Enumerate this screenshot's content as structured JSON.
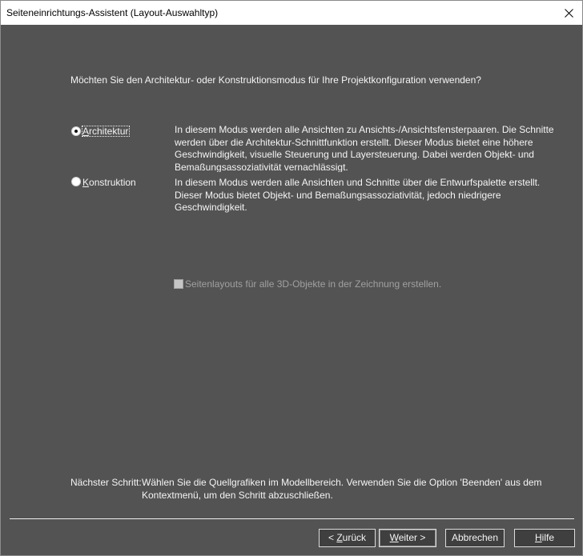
{
  "window": {
    "title": "Seiteneinrichtungs-Assistent (Layout-Auswahltyp)"
  },
  "icons": {
    "close": "close-icon"
  },
  "colors": {
    "titlebar_bg": "#ffffff",
    "body_bg": "#535353",
    "text": "#f4f4f4",
    "disabled_text": "#a0a0a0",
    "button_bg": "#3f3f3f",
    "button_border": "#dcdcdc",
    "separator": "#eeeeee"
  },
  "question": "Möchten Sie den Architektur- oder Konstruktionsmodus für Ihre Projektkonfiguration verwenden?",
  "modes": [
    {
      "label": "Architektur",
      "mnemonic_index": 0,
      "selected": true,
      "focused": true,
      "description_lines": [
        "In diesem Modus werden alle Ansichten zu Ansichts-/Ansichtsfensterpaaren. Die Schnitte",
        "werden über die Architektur-Schnittfunktion erstellt. Dieser Modus bietet eine höhere",
        "Geschwindigkeit, visuelle Steuerung und Layersteuerung. Dabei werden Objekt- und",
        "Bemaßungsassoziativität vernachlässigt."
      ]
    },
    {
      "label": "Konstruktion",
      "mnemonic_index": 0,
      "selected": false,
      "focused": false,
      "description_lines": [
        "In diesem Modus werden alle Ansichten und Schnitte über die Entwurfspalette erstellt.",
        "Dieser Modus bietet Objekt- und Bemaßungsassoziativität, jedoch niedrigere",
        "Geschwindigkeit."
      ]
    }
  ],
  "layout_checkbox": {
    "label": "Seitenlayouts für alle 3D-Objekte in der Zeichnung erstellen.",
    "checked": false,
    "disabled": true
  },
  "next_step": {
    "heading": "Nächster Schritt:",
    "lines": [
      "Wählen Sie die Quellgrafiken im Modellbereich. Verwenden Sie die Option 'Beenden' aus dem",
      "Kontextmenü, um den Schritt abzuschließen."
    ]
  },
  "buttons": {
    "back": {
      "label": "< Zurück",
      "mnemonic_index": 2
    },
    "next": {
      "label": "Weiter >",
      "mnemonic_index": 0,
      "default": true
    },
    "cancel": {
      "label": "Abbrechen"
    },
    "help": {
      "label": "Hilfe",
      "mnemonic_index": 0
    }
  }
}
